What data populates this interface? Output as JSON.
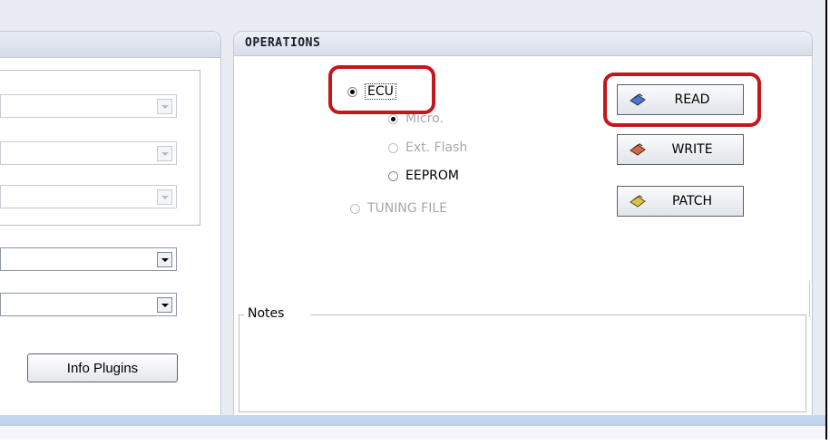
{
  "operations": {
    "title": "OPERATIONS",
    "radios": {
      "ecu": "ECU",
      "micro": "Micro.",
      "ext_flash": "Ext. Flash",
      "eeprom": "EEPROM",
      "tuning_file": "TUNING FILE"
    },
    "buttons": {
      "read": "READ",
      "write": "WRITE",
      "patch": "PATCH"
    },
    "notes_label": "Notes"
  },
  "left": {
    "info_plugins": "Info Plugins"
  },
  "colors": {
    "highlight": "#c4161c",
    "bottom_bar": "#b2c6e6"
  }
}
